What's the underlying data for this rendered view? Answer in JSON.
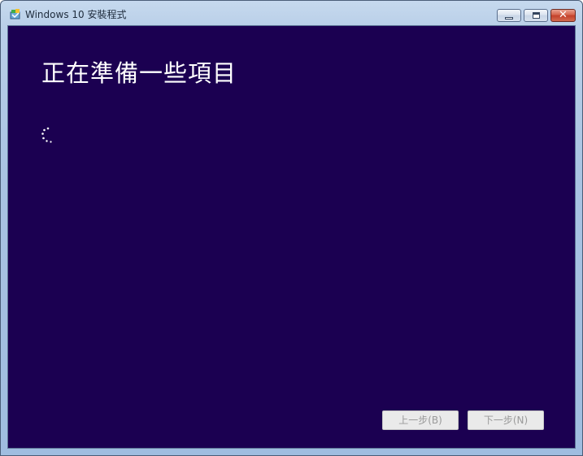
{
  "window": {
    "title": "Windows 10 安裝程式"
  },
  "main": {
    "heading": "正在準備一些項目",
    "status": "loading"
  },
  "footer": {
    "back_label": "上一步(B)",
    "next_label": "下一步(N)",
    "back_enabled": false,
    "next_enabled": false
  },
  "icons": {
    "app": "windows-setup-icon",
    "minimize": "minimize-icon",
    "maximize": "maximize-icon",
    "close": "close-icon",
    "spinner": "loading-spinner-icon"
  },
  "colors": {
    "background": "#1b0051",
    "heading_text": "#ffffff",
    "button_disabled_text": "#9a9a9a"
  }
}
